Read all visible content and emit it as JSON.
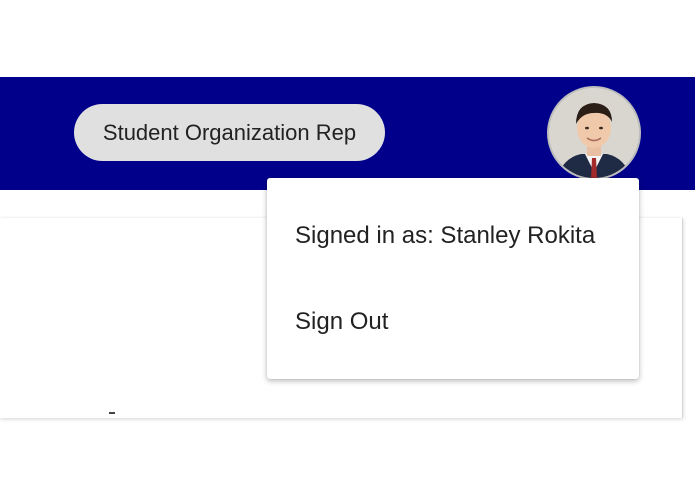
{
  "header": {
    "role_label": "Student Organization Rep",
    "background_color": "#00008b",
    "avatar_icon": "user-profile-photo"
  },
  "account_menu": {
    "signed_in_label": "Signed in as: Stanley Rokita",
    "sign_out_label": "Sign Out"
  }
}
